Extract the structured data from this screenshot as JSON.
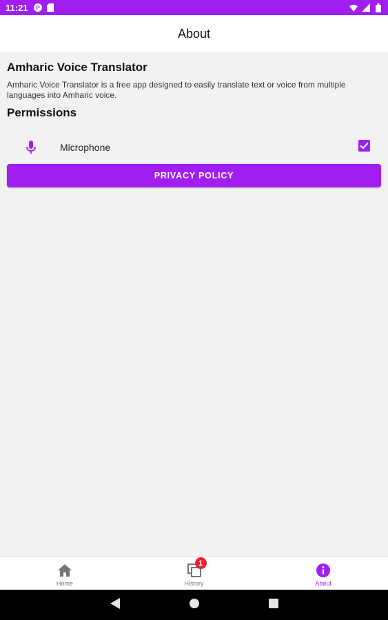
{
  "status_bar": {
    "time": "11:21",
    "left_icons": [
      "p-icon",
      "sd-card-icon"
    ],
    "right_icons": [
      "wifi-icon",
      "signal-icon",
      "battery-icon"
    ]
  },
  "app_bar": {
    "title": "About"
  },
  "about": {
    "app_name": "Amharic Voice Translator",
    "description": "Amharic Voice Translator is a free app designed to easily translate text or voice from multiple languages into Amharic voice.",
    "permissions_heading": "Permissions",
    "permissions": [
      {
        "icon": "microphone-icon",
        "label": "Microphone",
        "granted": true
      }
    ],
    "privacy_button": "PRIVACY POLICY"
  },
  "bottom_nav": {
    "items": [
      {
        "label": "Home",
        "icon": "home-icon",
        "active": false
      },
      {
        "label": "History",
        "icon": "history-icon",
        "active": false,
        "badge": "1"
      },
      {
        "label": "About",
        "icon": "info-icon",
        "active": true
      }
    ]
  },
  "system_nav": {
    "buttons": [
      "back-icon",
      "home-circle-icon",
      "recents-icon"
    ]
  },
  "colors": {
    "accent": "#a01ff0",
    "badge": "#e8232c",
    "background": "#f2f2f3"
  }
}
